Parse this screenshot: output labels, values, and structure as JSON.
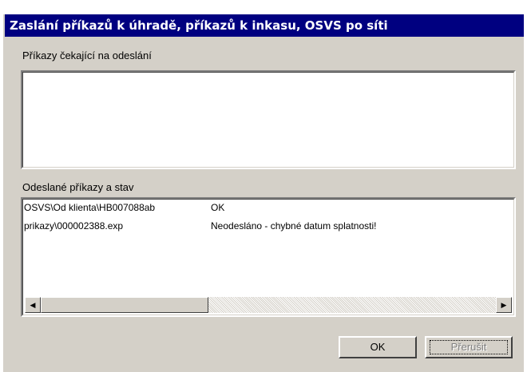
{
  "window": {
    "title": "Zaslání příkazů k úhradě, příkazů k inkasu, OSVS po síti"
  },
  "pending": {
    "label": "Příkazy čekající na odeslání",
    "items": []
  },
  "sent": {
    "label": "Odeslané příkazy a stav",
    "rows": [
      {
        "file": "OSVS\\Od klienta\\HB007088ab",
        "status": "OK"
      },
      {
        "file": "prikazy\\000002388.exp",
        "status": "Neodesláno - chybné datum splatnosti!"
      }
    ]
  },
  "scrollbar": {
    "left_arrow": "◀",
    "right_arrow": "▶"
  },
  "buttons": {
    "ok": "OK",
    "cancel": "Přerušit"
  }
}
